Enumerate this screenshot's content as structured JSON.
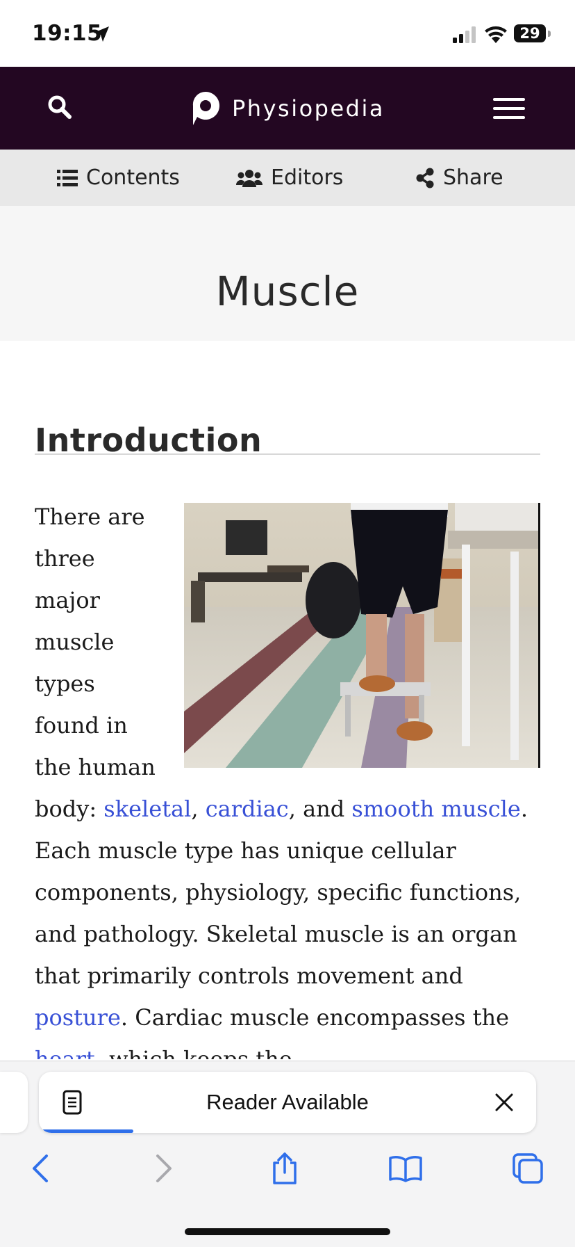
{
  "status_bar": {
    "time": "19:15",
    "battery": "29"
  },
  "header": {
    "site_name": "Physiopedia",
    "accent": "#230722"
  },
  "subnav": {
    "contents": "Contents",
    "editors": "Editors",
    "share": "Share"
  },
  "page": {
    "title": "Muscle"
  },
  "article": {
    "heading": "Introduction",
    "image_alt": "Person's legs stepping on a low step in a physiotherapy clinic",
    "p1_text_a": "There are three major muscle types found in the human body: ",
    "link_skeletal": "skeletal",
    "sep1": ", ",
    "link_cardiac": "cardiac",
    "sep2": ", and ",
    "link_smooth": "smooth muscle",
    "p1_text_b": ". Each muscle type has unique cellular components, physiology, specific functions, and pathology. Skeletal muscle is an organ that primarily controls movement and ",
    "link_posture": "posture",
    "p1_text_c": ". Cardiac muscle encompasses the ",
    "link_heart": "heart",
    "p1_text_d": ", which keeps the",
    "link_color": "#3850d6"
  },
  "reader": {
    "label": "Reader Available",
    "progress": 0.19
  },
  "toolbar": {
    "icons": [
      "back-icon",
      "forward-icon",
      "share-icon",
      "bookmarks-icon",
      "tabs-icon"
    ]
  }
}
